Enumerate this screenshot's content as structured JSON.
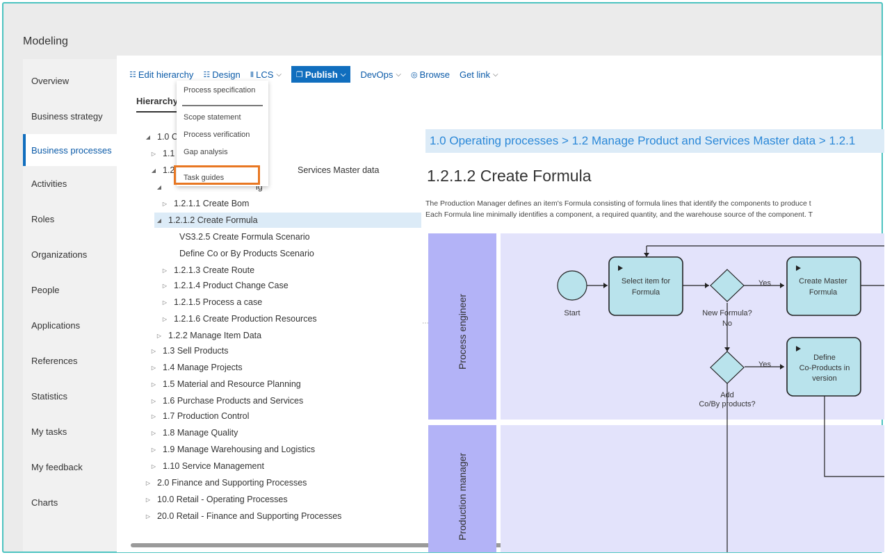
{
  "app": {
    "title": "Modeling"
  },
  "sidebar": {
    "items": [
      {
        "label": "Overview"
      },
      {
        "label": "Business strategy"
      },
      {
        "label": "Business processes"
      },
      {
        "label": "Activities"
      },
      {
        "label": "Roles"
      },
      {
        "label": "Organizations"
      },
      {
        "label": "People"
      },
      {
        "label": "Applications"
      },
      {
        "label": "References"
      },
      {
        "label": "Statistics"
      },
      {
        "label": "My tasks"
      },
      {
        "label": "My feedback"
      },
      {
        "label": "Charts"
      }
    ],
    "active_index": 2
  },
  "toolbar": {
    "edit_hierarchy": "Edit hierarchy",
    "design": "Design",
    "lcs": "LCS",
    "publish": "Publish",
    "devops": "DevOps",
    "browse": "Browse",
    "get_link": "Get link"
  },
  "tabs": {
    "hierarchy": "Hierarchy"
  },
  "publish_menu": {
    "items": [
      "Process specification",
      "Scope statement",
      "Process verification",
      "Gap analysis",
      "Task guides"
    ],
    "highlighted": "Task guides"
  },
  "tree": {
    "rows": [
      {
        "label": "1.0 C",
        "toggle": "expanded"
      },
      {
        "label": "1.1",
        "toggle": "collapsed"
      },
      {
        "label": "1.2",
        "toggle": "expanded",
        "suffix": "Services Master data"
      },
      {
        "label": "",
        "toggle": "expanded",
        "suffix": "ig"
      },
      {
        "label": "1.2.1.1 Create Bom",
        "toggle": "collapsed"
      },
      {
        "label": "1.2.1.2 Create Formula",
        "toggle": "expanded",
        "selected": true
      },
      {
        "label": "VS3.2.5 Create Formula Scenario",
        "toggle": "none"
      },
      {
        "label": "Define Co or By Products Scenario",
        "toggle": "none"
      },
      {
        "label": "1.2.1.3 Create Route",
        "toggle": "collapsed"
      },
      {
        "label": "1.2.1.4 Product Change Case",
        "toggle": "collapsed"
      },
      {
        "label": "1.2.1.5 Process a case",
        "toggle": "collapsed"
      },
      {
        "label": "1.2.1.6 Create Production Resources",
        "toggle": "collapsed"
      },
      {
        "label": "1.2.2 Manage Item Data",
        "toggle": "collapsed"
      },
      {
        "label": "1.3 Sell Products",
        "toggle": "collapsed"
      },
      {
        "label": "1.4 Manage Projects",
        "toggle": "collapsed"
      },
      {
        "label": "1.5 Material and Resource Planning",
        "toggle": "collapsed"
      },
      {
        "label": "1.6 Purchase Products and Services",
        "toggle": "collapsed"
      },
      {
        "label": "1.7 Production Control",
        "toggle": "collapsed"
      },
      {
        "label": "1.8 Manage Quality",
        "toggle": "collapsed"
      },
      {
        "label": "1.9 Manage Warehousing and Logistics",
        "toggle": "collapsed"
      },
      {
        "label": "1.10 Service Management",
        "toggle": "collapsed"
      },
      {
        "label": "2.0 Finance and Supporting Processes",
        "toggle": "collapsed"
      },
      {
        "label": "10.0 Retail - Operating Processes",
        "toggle": "collapsed"
      },
      {
        "label": "20.0 Retail - Finance and Supporting Processes",
        "toggle": "collapsed"
      }
    ]
  },
  "detail": {
    "breadcrumb": "1.0 Operating processes > 1.2 Manage Product and Services Master data > 1.2.1",
    "title": "1.2.1.2 Create Formula",
    "description_line1": "The Production Manager defines an item's Formula consisting of formula lines that identify the components to produce t",
    "description_line2": "Each Formula line minimally identifies a component, a required quantity, and the warehouse source of the component. T"
  },
  "diagram": {
    "lanes": [
      "Process engineer",
      "Production manager"
    ],
    "start_label": "Start",
    "task_select": [
      "Select item for",
      "Formula"
    ],
    "task_create_master": [
      "Create Master",
      "Formula"
    ],
    "task_define": [
      "Define",
      "Co-Products in",
      "version"
    ],
    "gateway_new": "New Formula?",
    "gateway_add": [
      "Add",
      "Co/By products?"
    ],
    "yes1": "Yes",
    "no1": "No",
    "yes2": "Yes",
    "lane_fill": "#e3e3fb",
    "header_fill": "#b3b3f7",
    "task_fill": "#b9e3ec"
  }
}
